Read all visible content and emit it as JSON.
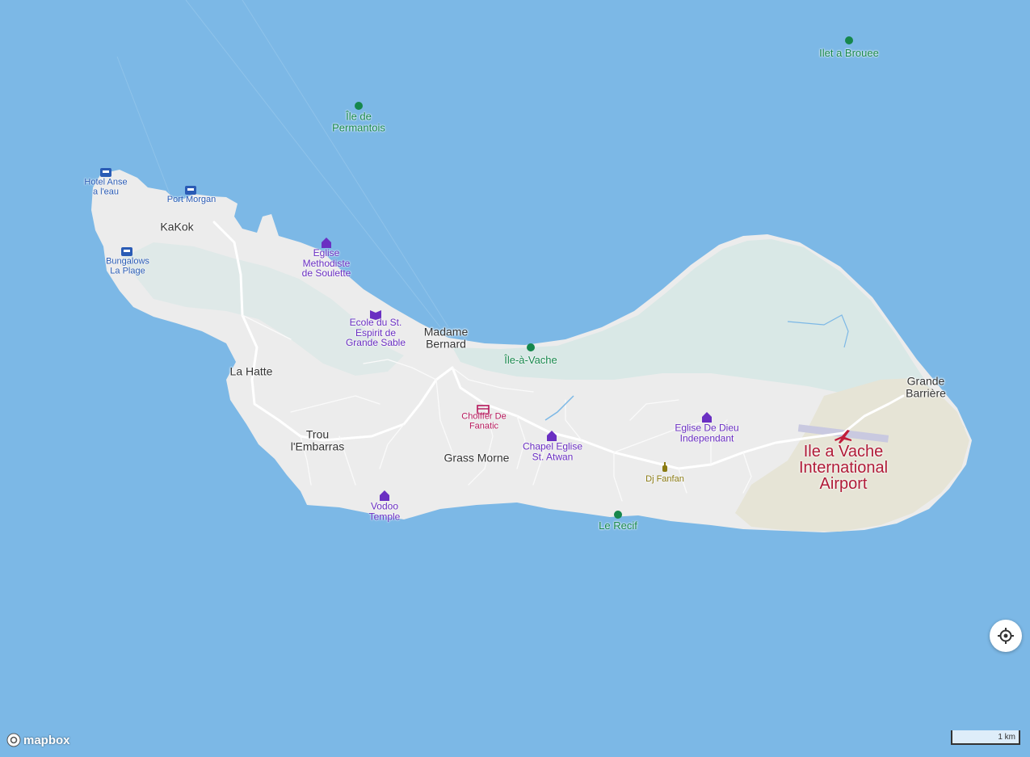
{
  "map": {
    "colors": {
      "water": "#7cb8e6",
      "land": "#ececec",
      "wetland": "#d8e8e5",
      "airport": "#e6e5d8",
      "road": "#ffffff"
    },
    "places": {
      "kakok": "KaKok",
      "la_hatte": "La Hatte",
      "madame_bernard": "Madame\nBernard",
      "trou_embarras": "Trou\nl'Embarras",
      "grass_morne": "Grass Morne",
      "grande_barriere": "Grande\nBarrière"
    },
    "pois": {
      "hotel_anse": "Hotel Anse\na l'eau",
      "port_morgan": "Port Morgan",
      "bungalows": "Bungalows\nLa Plage",
      "eglise_methodiste": "Eglise\nMethodiste\nde Soulette",
      "ecole": "Ecole du St.\nEspirit de\nGrande Sable",
      "chapel": "Chapel Eglise\nSt. Atwan",
      "eglise_dieu": "Eglise De Dieu\nIndependant",
      "vodoo": "Vodoo\nTemple",
      "choiffer": "Choiffer De\nFanatic",
      "dj_fanfan": "Dj Fanfan"
    },
    "islands": {
      "ilet_brouee": "Ilet a Brouee",
      "ile_permantois": "Île de\nPermantois",
      "ile_a_vache": "Île-à-Vache",
      "le_recif": "Le Recif"
    },
    "airport": {
      "label": "Ile a Vache\nInternational\nAirport",
      "icon": "airplane-icon"
    },
    "scale_label": "1 km",
    "logo_text": "mapbox",
    "locate_icon": "crosshair-icon"
  }
}
